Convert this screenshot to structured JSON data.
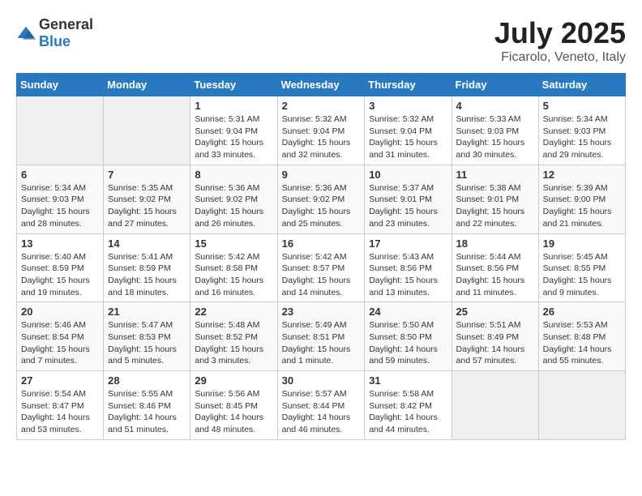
{
  "header": {
    "logo_general": "General",
    "logo_blue": "Blue",
    "month": "July 2025",
    "location": "Ficarolo, Veneto, Italy"
  },
  "weekdays": [
    "Sunday",
    "Monday",
    "Tuesday",
    "Wednesday",
    "Thursday",
    "Friday",
    "Saturday"
  ],
  "weeks": [
    [
      {
        "day": "",
        "info": ""
      },
      {
        "day": "",
        "info": ""
      },
      {
        "day": "1",
        "info": "Sunrise: 5:31 AM\nSunset: 9:04 PM\nDaylight: 15 hours and 33 minutes."
      },
      {
        "day": "2",
        "info": "Sunrise: 5:32 AM\nSunset: 9:04 PM\nDaylight: 15 hours and 32 minutes."
      },
      {
        "day": "3",
        "info": "Sunrise: 5:32 AM\nSunset: 9:04 PM\nDaylight: 15 hours and 31 minutes."
      },
      {
        "day": "4",
        "info": "Sunrise: 5:33 AM\nSunset: 9:03 PM\nDaylight: 15 hours and 30 minutes."
      },
      {
        "day": "5",
        "info": "Sunrise: 5:34 AM\nSunset: 9:03 PM\nDaylight: 15 hours and 29 minutes."
      }
    ],
    [
      {
        "day": "6",
        "info": "Sunrise: 5:34 AM\nSunset: 9:03 PM\nDaylight: 15 hours and 28 minutes."
      },
      {
        "day": "7",
        "info": "Sunrise: 5:35 AM\nSunset: 9:02 PM\nDaylight: 15 hours and 27 minutes."
      },
      {
        "day": "8",
        "info": "Sunrise: 5:36 AM\nSunset: 9:02 PM\nDaylight: 15 hours and 26 minutes."
      },
      {
        "day": "9",
        "info": "Sunrise: 5:36 AM\nSunset: 9:02 PM\nDaylight: 15 hours and 25 minutes."
      },
      {
        "day": "10",
        "info": "Sunrise: 5:37 AM\nSunset: 9:01 PM\nDaylight: 15 hours and 23 minutes."
      },
      {
        "day": "11",
        "info": "Sunrise: 5:38 AM\nSunset: 9:01 PM\nDaylight: 15 hours and 22 minutes."
      },
      {
        "day": "12",
        "info": "Sunrise: 5:39 AM\nSunset: 9:00 PM\nDaylight: 15 hours and 21 minutes."
      }
    ],
    [
      {
        "day": "13",
        "info": "Sunrise: 5:40 AM\nSunset: 8:59 PM\nDaylight: 15 hours and 19 minutes."
      },
      {
        "day": "14",
        "info": "Sunrise: 5:41 AM\nSunset: 8:59 PM\nDaylight: 15 hours and 18 minutes."
      },
      {
        "day": "15",
        "info": "Sunrise: 5:42 AM\nSunset: 8:58 PM\nDaylight: 15 hours and 16 minutes."
      },
      {
        "day": "16",
        "info": "Sunrise: 5:42 AM\nSunset: 8:57 PM\nDaylight: 15 hours and 14 minutes."
      },
      {
        "day": "17",
        "info": "Sunrise: 5:43 AM\nSunset: 8:56 PM\nDaylight: 15 hours and 13 minutes."
      },
      {
        "day": "18",
        "info": "Sunrise: 5:44 AM\nSunset: 8:56 PM\nDaylight: 15 hours and 11 minutes."
      },
      {
        "day": "19",
        "info": "Sunrise: 5:45 AM\nSunset: 8:55 PM\nDaylight: 15 hours and 9 minutes."
      }
    ],
    [
      {
        "day": "20",
        "info": "Sunrise: 5:46 AM\nSunset: 8:54 PM\nDaylight: 15 hours and 7 minutes."
      },
      {
        "day": "21",
        "info": "Sunrise: 5:47 AM\nSunset: 8:53 PM\nDaylight: 15 hours and 5 minutes."
      },
      {
        "day": "22",
        "info": "Sunrise: 5:48 AM\nSunset: 8:52 PM\nDaylight: 15 hours and 3 minutes."
      },
      {
        "day": "23",
        "info": "Sunrise: 5:49 AM\nSunset: 8:51 PM\nDaylight: 15 hours and 1 minute."
      },
      {
        "day": "24",
        "info": "Sunrise: 5:50 AM\nSunset: 8:50 PM\nDaylight: 14 hours and 59 minutes."
      },
      {
        "day": "25",
        "info": "Sunrise: 5:51 AM\nSunset: 8:49 PM\nDaylight: 14 hours and 57 minutes."
      },
      {
        "day": "26",
        "info": "Sunrise: 5:53 AM\nSunset: 8:48 PM\nDaylight: 14 hours and 55 minutes."
      }
    ],
    [
      {
        "day": "27",
        "info": "Sunrise: 5:54 AM\nSunset: 8:47 PM\nDaylight: 14 hours and 53 minutes."
      },
      {
        "day": "28",
        "info": "Sunrise: 5:55 AM\nSunset: 8:46 PM\nDaylight: 14 hours and 51 minutes."
      },
      {
        "day": "29",
        "info": "Sunrise: 5:56 AM\nSunset: 8:45 PM\nDaylight: 14 hours and 48 minutes."
      },
      {
        "day": "30",
        "info": "Sunrise: 5:57 AM\nSunset: 8:44 PM\nDaylight: 14 hours and 46 minutes."
      },
      {
        "day": "31",
        "info": "Sunrise: 5:58 AM\nSunset: 8:42 PM\nDaylight: 14 hours and 44 minutes."
      },
      {
        "day": "",
        "info": ""
      },
      {
        "day": "",
        "info": ""
      }
    ]
  ]
}
